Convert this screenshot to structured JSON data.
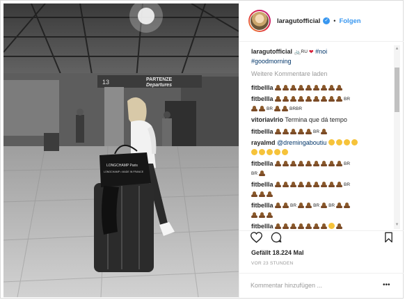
{
  "post": {
    "username": "laragutofficial",
    "follow_label": "Folgen",
    "separator": "•",
    "photo_sign_number": "13",
    "photo_sign_line1": "PARTENZE",
    "photo_sign_line2": "Departures",
    "bag_text_1": "LONGCHAMP Paris",
    "bag_text_2": "LONGCHAMP • MADE IN FRANCE"
  },
  "caption": {
    "user": "laragutofficial",
    "flag": "RU",
    "hashtag_1": "#noi",
    "hashtag_2": "#goodmorning"
  },
  "load_more": "Weitere Kommentare laden",
  "comments": [
    {
      "user": "fitbellla",
      "poo_before_br": 9,
      "br": "",
      "poo_after_br": 0
    },
    {
      "user": "fitbellla"
    },
    {
      "user": "vitoriavlrio",
      "text": "Termina que dá tempo"
    },
    {
      "user": "fitbellla"
    },
    {
      "user": "rayalmd",
      "mention": "@dremingaboutiu"
    },
    {
      "user": "fitbellla"
    },
    {
      "user": "fitbellla"
    },
    {
      "user": "fitbellla"
    },
    {
      "user": "fitbellla"
    }
  ],
  "br_label": "BR",
  "brbr_label": "BRBR",
  "likes_text": "Gefällt 18.224 Mal",
  "timestamp": "VOR 23 STUNDEN",
  "comment_placeholder": "Kommentar hinzufügen ...",
  "more_label": "•••",
  "icons": {
    "heart": "heart-icon",
    "comment": "comment-icon",
    "bookmark": "bookmark-icon",
    "verified": "verified-badge-icon"
  },
  "colors": {
    "link_blue": "#3897f0",
    "verified_blue": "#3897f0",
    "hashtag": "#003569",
    "muted": "#999999"
  }
}
